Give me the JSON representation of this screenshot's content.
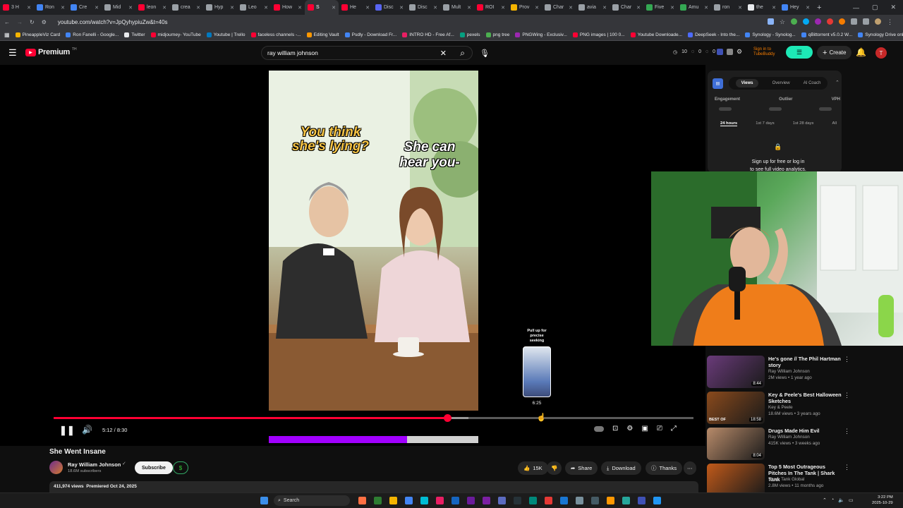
{
  "browser": {
    "tabs": [
      {
        "label": "3 H",
        "color": "#ff0033"
      },
      {
        "label": "Ron",
        "color": "#4285f4"
      },
      {
        "label": "Cre",
        "color": "#4285f4"
      },
      {
        "label": "Mid",
        "color": "#9aa0a6"
      },
      {
        "label": "leon",
        "color": "#ff0033"
      },
      {
        "label": "crea",
        "color": "#9aa0a6"
      },
      {
        "label": "Hyp",
        "color": "#9aa0a6"
      },
      {
        "label": "Leo",
        "color": "#9aa0a6"
      },
      {
        "label": "How",
        "color": "#ff0033"
      },
      {
        "label": "S",
        "color": "#ff0033",
        "active": true
      },
      {
        "label": "He",
        "color": "#ff0033"
      },
      {
        "label": "Disc",
        "color": "#5865f2"
      },
      {
        "label": "Disc",
        "color": "#9aa0a6"
      },
      {
        "label": "Mult",
        "color": "#9aa0a6"
      },
      {
        "label": "ROI",
        "color": "#ff0033"
      },
      {
        "label": "Prov",
        "color": "#f4b400"
      },
      {
        "label": "Char",
        "color": "#9aa0a6"
      },
      {
        "label": "avia",
        "color": "#9aa0a6"
      },
      {
        "label": "Char",
        "color": "#9aa0a6"
      },
      {
        "label": "Five",
        "color": "#34a853"
      },
      {
        "label": "Amu",
        "color": "#34a853"
      },
      {
        "label": "ron",
        "color": "#9aa0a6"
      },
      {
        "label": "the",
        "color": "#e8eaed"
      },
      {
        "label": "Hey",
        "color": "#4285f4"
      }
    ],
    "url": "youtube.com/watch?v=JpQyhypiuZw&t=40s",
    "bookmarks": [
      "PineappleViz Card",
      "Ron Fanelli - Google...",
      "Twitter",
      "midjourney- YouTube",
      "Youtube | Trello",
      "faceless channels -...",
      "Editing Vault",
      "Psdly - Download Fr...",
      "INTRO HD - Free Af...",
      "pexels",
      "png tree",
      "PNGWing - Exclusiv...",
      "PNG images | 100 0...",
      "Youtube Downloade...",
      "DeepSeek - Into the...",
      "Synology - Synolog...",
      "qBittorrent v5.0.2 W...",
      "Synology Drive online"
    ]
  },
  "youtube": {
    "logo_text": "Premium",
    "logo_badge": "TH",
    "search_value": "ray william johnson",
    "stats": [
      "10",
      "0",
      "0"
    ],
    "tubebuddy_text": [
      "Sign in to",
      "TubeBuddy"
    ],
    "create_label": "Create",
    "avatar_letter": "T"
  },
  "video": {
    "caption_left": [
      "You think",
      "she's lying?"
    ],
    "caption_right": [
      "She can",
      "hear you-"
    ],
    "seek_tip": [
      "Pull up for",
      "precise",
      "seeking"
    ],
    "seek_time": "6:25",
    "time": "5:12 / 8:30",
    "progress": 0.615,
    "buffered_to": 0.648,
    "hover_at": 0.758
  },
  "meta": {
    "title": "She Went Insane",
    "channel": "Ray William Johnson",
    "subscribers": "18.6M subscribers",
    "subscribe_label": "Subscribe",
    "likes": "15K",
    "share_label": "Share",
    "download_label": "Download",
    "thanks_label": "Thanks",
    "views_line": "411,974 views  Premiered Oct 24, 2025"
  },
  "panel": {
    "tabs": [
      "Views",
      "Overview",
      "AI Coach"
    ],
    "metrics": [
      "Engagement",
      "Outlier",
      "VPH"
    ],
    "ranges": [
      "24 hours",
      "1st 7 days",
      "1st 28 days",
      "All"
    ],
    "lock_text_1": "Sign up for free or log in",
    "lock_text_2": "to see full video analytics."
  },
  "recommendations": [
    {
      "title": "He's gone // The Phil Hartman story",
      "channel": "Ray William Johnson",
      "meta": "2M views • 1 year ago",
      "duration": "8:44",
      "color": "#6a3b7a"
    },
    {
      "title": "Key & Peele's Best Halloween Sketches",
      "channel": "Key & Peele",
      "meta": "18.6M views • 3 years ago",
      "duration": "18:58",
      "badge": "BEST OF",
      "color": "#8a4a1c"
    },
    {
      "title": "Drugs Made Him Evil",
      "channel": "Ray William Johnson",
      "meta": "415K views • 3 weeks ago",
      "duration": "8:04",
      "color": "#b88b6a"
    },
    {
      "title": "Top 5 Most Outrageous Pitches In The Tank | Shark Tank",
      "channel": "Shark Tank Global",
      "meta": "2.8M views • 11 months ago",
      "duration": "",
      "color": "#c15a1a"
    }
  ],
  "taskbar": {
    "search_label": "Search",
    "clock_time": "3:22 PM",
    "clock_date": "2025-10-29"
  }
}
